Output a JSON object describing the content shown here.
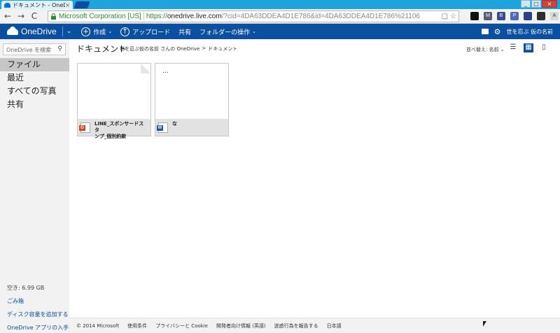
{
  "browser": {
    "tab_title": "ドキュメント - OneDrive",
    "tab_close": "×",
    "window_min": "_",
    "window_max": "□",
    "window_close": "×",
    "nav_back": "←",
    "nav_forward": "→",
    "nav_reload": "C",
    "nav_home": "⌂",
    "ev_label": "Microsoft Corporation [US]",
    "url_scheme": "https://",
    "url_host": "onedrive.live.com",
    "url_rest": "/?cid=4DA63DDEA4D1E786&id=4DA63DDEA4D1E786%21106",
    "extensions": [
      {
        "icon": "black-square-icon",
        "label": "",
        "color": "#111111"
      },
      {
        "icon": "mail-icon",
        "label": "M",
        "color": "#5a5a7a"
      },
      {
        "icon": "extension-b-icon",
        "label": "B",
        "color": "#3b4a8a"
      },
      {
        "icon": "extension-p-icon",
        "label": "P",
        "color": "#4a6ab8"
      },
      {
        "icon": "monitor-icon",
        "label": "",
        "color": "#2b3f8a"
      },
      {
        "icon": "person-icon",
        "label": "",
        "color": "#2d2d2d"
      },
      {
        "icon": "font-a-icon",
        "label": "A",
        "color": "#d8d8d8"
      },
      {
        "icon": "menu-icon",
        "label": "≡",
        "color": "#c49a2a"
      }
    ]
  },
  "header": {
    "logo": "OneDrive",
    "create": "作成",
    "upload": "アップロード",
    "share": "共有",
    "folder_ops": "フォルダーの操作",
    "user_name": "世を忍ぶ 仮の名前"
  },
  "sidebar": {
    "search_placeholder": "OneDrive を検索",
    "items": [
      {
        "label": "ファイル"
      },
      {
        "label": "最近"
      },
      {
        "label": "すべての写真"
      },
      {
        "label": "共有"
      }
    ],
    "storage": "空き: 6.99 GB",
    "recycle": "ごみ箱",
    "add_storage": "ディスク容量を追加する",
    "get_apps": "OneDrive アプリの入手"
  },
  "main": {
    "title": "ドキュメント",
    "breadcrumb": [
      "世を忍ぶ仮の名前 さんの OneDrive",
      ">",
      "ドキュメント"
    ],
    "sort_label": "並べ替え: 名前 ⌄",
    "files": [
      {
        "name_line1": "LINE_スポンサードスタ",
        "name_line2": "ンプ_個別約款",
        "preview": "",
        "badge": "O",
        "badge_color": "#d24726"
      },
      {
        "name_line1": "な",
        "name_line2": "",
        "preview": "...",
        "badge": "W",
        "badge_color": "#2b579a"
      }
    ]
  },
  "footer": {
    "links": [
      "© 2014 Microsoft",
      "使用条件",
      "プライバシーと Cookie",
      "開発者向け情報 (英語)",
      "迷惑行為を報告する",
      "日本語"
    ]
  }
}
